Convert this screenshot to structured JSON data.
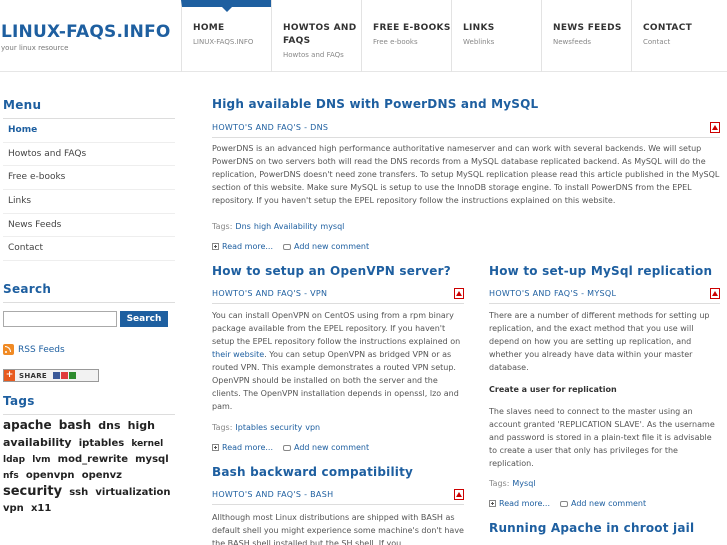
{
  "header": {
    "logo": "LINUX-FAQS.INFO",
    "tagline": "your linux resource",
    "nav": [
      {
        "label": "HOME",
        "sub": "LINUX-FAQS.INFO"
      },
      {
        "label": "HOWTOS AND FAQS",
        "sub": "Howtos and FAQs"
      },
      {
        "label": "FREE E-BOOKS",
        "sub": "Free e-books"
      },
      {
        "label": "LINKS",
        "sub": "Weblinks"
      },
      {
        "label": "NEWS FEEDS",
        "sub": "Newsfeeds"
      },
      {
        "label": "CONTACT",
        "sub": "Contact"
      }
    ]
  },
  "sidebar": {
    "menu_heading": "Menu",
    "menu": [
      "Home",
      "Howtos and FAQs",
      "Free e-books",
      "Links",
      "News Feeds",
      "Contact"
    ],
    "search_heading": "Search",
    "search_value": "",
    "search_button": "Search",
    "rss_label": "RSS Feeds",
    "share_label": "SHARE",
    "tags_heading": "Tags",
    "tags": [
      {
        "text": "apache",
        "size": 12
      },
      {
        "text": "bash",
        "size": 12
      },
      {
        "text": "dns",
        "size": 11
      },
      {
        "text": "high",
        "size": 11
      },
      {
        "text": "availability",
        "size": 11
      },
      {
        "text": "iptables",
        "size": 10
      },
      {
        "text": "kernel",
        "size": 9
      },
      {
        "text": "ldap",
        "size": 9
      },
      {
        "text": "lvm",
        "size": 9
      },
      {
        "text": "mod_rewrite",
        "size": 10
      },
      {
        "text": "mysql",
        "size": 10
      },
      {
        "text": "nfs",
        "size": 9
      },
      {
        "text": "openvpn",
        "size": 10
      },
      {
        "text": "openvz",
        "size": 10
      },
      {
        "text": "security",
        "size": 13
      },
      {
        "text": "ssh",
        "size": 10
      },
      {
        "text": "virtualization",
        "size": 10
      },
      {
        "text": "vpn",
        "size": 10
      },
      {
        "text": "x11",
        "size": 10
      }
    ]
  },
  "posts": {
    "dns": {
      "title": "High available DNS with PowerDNS and MySQL",
      "category": "HOWTO'S AND FAQ'S - DNS",
      "body": "PowerDNS is an advanced high performance authoritative nameserver and can work with several backends. We will setup PowerDNS on two servers both will read the DNS records from a MySQL database replicated backend. As MySQL will do the replication, PowerDNS doesn't need zone transfers. To setup MySQL replication please read this article published in the MySQL section of this website. Make sure MySQL is setup to use the InnoDB storage engine. To install PowerDNS from the EPEL repository. If you haven't setup the EPEL repository follow the instructions explained on this website.",
      "tags_label": "Tags:",
      "tags": [
        "Dns",
        "high Availability",
        "mysql"
      ],
      "read_more": "Read more...",
      "add_comment": "Add new comment"
    },
    "openvpn": {
      "title": "How to setup an OpenVPN server?",
      "category": "HOWTO'S AND FAQ'S - VPN",
      "body_1": "You can install OpenVPN on CentOS using from a rpm binary package available from the EPEL repository. If you haven't setup the EPEL repository follow the instructions explained on ",
      "link": "their website",
      "body_2": ". You can setup OpenVPN as bridged VPN or as routed VPN. This example demonstrates a routed VPN setup. OpenVPN should be installed on both the server and the clients. The OpenVPN installation depends in openssl, lzo and pam.",
      "tags_label": "Tags:",
      "tags": [
        "Iptables",
        "security",
        "vpn"
      ],
      "read_more": "Read more...",
      "add_comment": "Add new comment"
    },
    "mysql": {
      "title": "How to set-up MySql replication",
      "category": "HOWTO'S AND FAQ'S - MYSQL",
      "body": "There are a number of different methods for setting up replication, and the exact method that you use will depend on how you are setting up replication, and whether you already have data within your master database.",
      "subheading": "Create a user for replication",
      "body_2": "The slaves need to connect to the master using an account granted 'REPLICATION SLAVE'. As the username and password is stored in a plain-text file it is advisable to create a user that only has privileges for the replication.",
      "tags_label": "Tags:",
      "tags": [
        "Mysql"
      ],
      "read_more": "Read more...",
      "add_comment": "Add new comment"
    },
    "bash": {
      "title": "Bash backward compatibility",
      "category": "HOWTO'S AND FAQ'S - BASH",
      "body": "Allthough most Linux distributions are shipped with BASH as default shell you might experience some machine's don't have the BASH shell installed but the SH shell. If you"
    },
    "apache": {
      "title": "Running Apache in chroot jail"
    }
  }
}
